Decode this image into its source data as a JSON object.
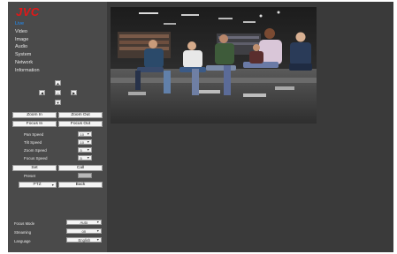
{
  "brand": {
    "logo_text": "JVC",
    "accent": "#e01818"
  },
  "menu": {
    "items": [
      {
        "label": "Live",
        "active": true
      },
      {
        "label": "Video",
        "active": false
      },
      {
        "label": "Image",
        "active": false
      },
      {
        "label": "Audio",
        "active": false
      },
      {
        "label": "System",
        "active": false
      },
      {
        "label": "Network",
        "active": false
      },
      {
        "label": "Information",
        "active": false
      }
    ]
  },
  "ptz_pad": {
    "up_icon": "triangle-up-icon",
    "down_icon": "triangle-down-icon",
    "left_icon": "triangle-left-icon",
    "right_icon": "triangle-right-icon",
    "home_icon": "home-icon"
  },
  "controls": {
    "zoom_in": "Zoom In",
    "zoom_out": "Zoom Out",
    "focus_in": "Focus In",
    "focus_out": "Focus Out",
    "pan_speed": {
      "label": "Pan Speed",
      "value": "10"
    },
    "tilt_speed": {
      "label": "Tilt Speed",
      "value": "10"
    },
    "zoom_speed": {
      "label": "Zoom Speed",
      "value": "5"
    },
    "focus_speed": {
      "label": "Focus Speed",
      "value": "5"
    },
    "set": "Set",
    "call": "Call",
    "preset_label": "Preset",
    "mode_select": "PTZ",
    "back": "Back"
  },
  "bottom_settings": {
    "focus_mode": {
      "label": "Focus Mode",
      "value": "Auto"
    },
    "streaming": {
      "label": "Streaming",
      "value": "on"
    },
    "language": {
      "label": "Language",
      "value": "English"
    }
  },
  "video": {
    "scene": "lecture-hall-students-live-view"
  }
}
